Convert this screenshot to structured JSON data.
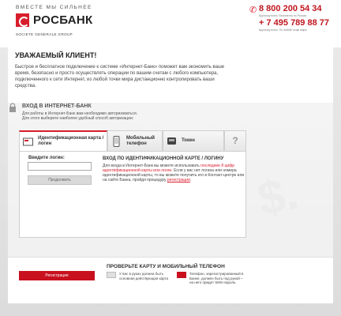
{
  "header": {
    "tagline": "ВМЕСТЕ МЫ СИЛЬНЕЕ",
    "brand": "РОСБАНК",
    "brand_sub": "SOCIETE GENERALE GROUP",
    "phone1": "8 800 200 54 34",
    "phone1_note": "Круглосуточно. Бесплатно по России",
    "phone2": "+ 7 495 789 88 77",
    "phone2_note": "Круглосуточно. По любой точки мира",
    "brand_color": "#d81e2c"
  },
  "welcome": {
    "title": "УВАЖАЕМЫЙ КЛИЕНТ!",
    "text": "Быстрое и бесплатное подключение к системе «Интернет-Банк» поможет вам экономить ваше время, безопасно и просто осуществлять операции по вашим счетам с любого компьютера, подключенного к сети Интернет, из любой точки мира дистанционно контролировать ваши средства."
  },
  "login": {
    "title": "ВХОД В ИНТЕРНЕТ-БАНК",
    "note_line1": "Для работы в Интернет-Банк вам необходимо авторизоваться.",
    "note_line2": "Для этого выберите наиболее удобный способ авторизации:",
    "tabs": [
      {
        "label": "Идентификационная карта / логин",
        "icon": "card-icon"
      },
      {
        "label": "Мобильный телефон",
        "icon": "mobile-phone-icon"
      },
      {
        "label": "Токен",
        "icon": "token-icon"
      },
      {
        "label": "?",
        "icon": "help-icon"
      }
    ],
    "field_label": "Введите логин:",
    "input_value": "",
    "continue_label": "Продолжить",
    "info_title": "ВХОД ПО ИДЕНТИФИКАЦИОННОЙ КАРТЕ / ЛОГИНУ",
    "info_p1_start": "Для входа в Интернет-Банк вы можете использовать ",
    "info_p1_red": "последние 8 цифр идентификационной карты или логин",
    "info_p1_end": ". Если у вас нет логина или номера идентификационной карты, то вы можете получить его в Контакт-центре или на сайте Банка, пройдя процедуру ",
    "info_p1_link": "регистрации",
    "info_p1_tail": "."
  },
  "bottom": {
    "register_label": "Регистрация",
    "check_title": "ПРОВЕРЬТЕ КАРТУ И МОБИЛЬНЫЙ ТЕЛЕФОН",
    "check_card": "У вас в руках должна быть основная действующая карта",
    "check_phone": "Телефон, зарегистрированный в Банке, должен быть под рукой – на него придет SMS-пароль."
  }
}
